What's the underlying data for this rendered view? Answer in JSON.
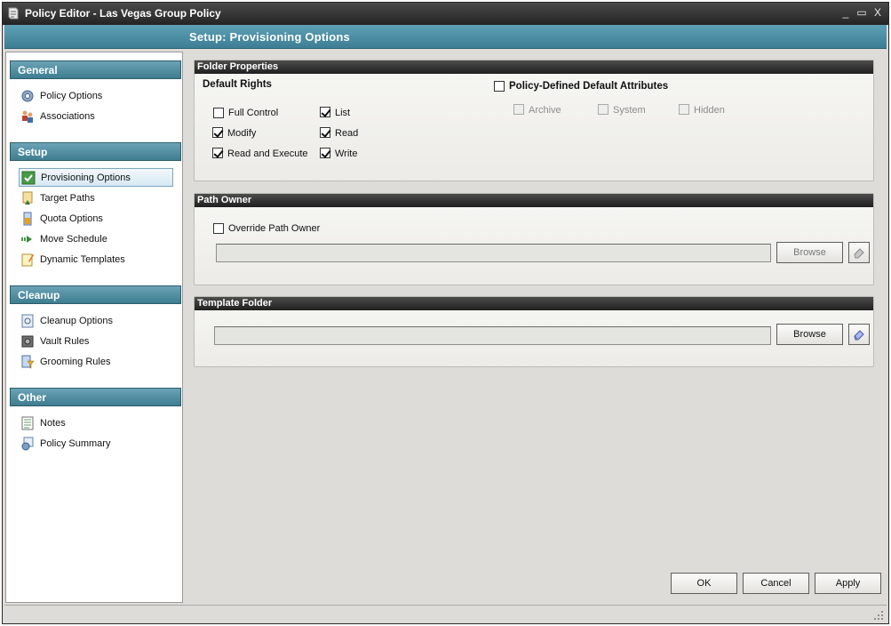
{
  "window": {
    "title": "Policy Editor - Las Vegas Group Policy",
    "controls": {
      "minimize": "_",
      "maximize": "▭",
      "close": "X"
    }
  },
  "header": {
    "title": "Setup: Provisioning Options"
  },
  "sidebar": {
    "sections": [
      {
        "label": "General",
        "items": [
          {
            "label": "Policy Options",
            "icon": "gear-icon"
          },
          {
            "label": "Associations",
            "icon": "users-icon"
          }
        ]
      },
      {
        "label": "Setup",
        "items": [
          {
            "label": "Provisioning Options",
            "icon": "check-icon",
            "selected": true
          },
          {
            "label": "Target Paths",
            "icon": "target-paths-icon"
          },
          {
            "label": "Quota Options",
            "icon": "quota-icon"
          },
          {
            "label": "Move Schedule",
            "icon": "move-arrow-icon"
          },
          {
            "label": "Dynamic Templates",
            "icon": "template-icon"
          }
        ]
      },
      {
        "label": "Cleanup",
        "items": [
          {
            "label": "Cleanup Options",
            "icon": "cleanup-icon"
          },
          {
            "label": "Vault Rules",
            "icon": "vault-icon"
          },
          {
            "label": "Grooming Rules",
            "icon": "grooming-icon"
          }
        ]
      },
      {
        "label": "Other",
        "items": [
          {
            "label": "Notes",
            "icon": "notes-icon"
          },
          {
            "label": "Policy Summary",
            "icon": "summary-icon"
          }
        ]
      }
    ]
  },
  "folder_properties": {
    "title": "Folder Properties",
    "default_rights": {
      "title": "Default Rights",
      "options": [
        {
          "label": "Full Control",
          "checked": false
        },
        {
          "label": "List",
          "checked": true
        },
        {
          "label": "Modify",
          "checked": true
        },
        {
          "label": "Read",
          "checked": true
        },
        {
          "label": "Read and Execute",
          "checked": true
        },
        {
          "label": "Write",
          "checked": true
        }
      ]
    },
    "default_attributes": {
      "label": "Policy-Defined Default Attributes",
      "checked": false,
      "options": [
        {
          "label": "Archive",
          "checked": false,
          "enabled": false
        },
        {
          "label": "System",
          "checked": false,
          "enabled": false
        },
        {
          "label": "Hidden",
          "checked": false,
          "enabled": false
        }
      ]
    }
  },
  "path_owner": {
    "title": "Path Owner",
    "override_label": "Override Path Owner",
    "override_checked": false,
    "value": "",
    "browse_label": "Browse",
    "browse_enabled": false
  },
  "template_folder": {
    "title": "Template Folder",
    "value": "",
    "browse_label": "Browse"
  },
  "footer": {
    "ok_label": "OK",
    "cancel_label": "Cancel",
    "apply_label": "Apply"
  }
}
